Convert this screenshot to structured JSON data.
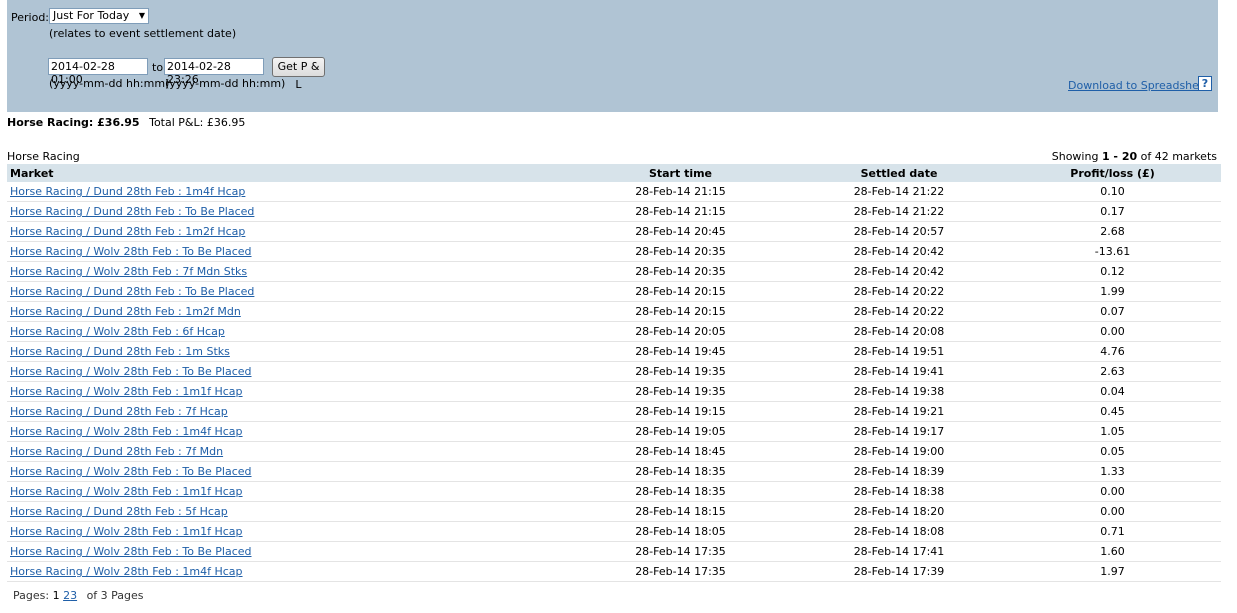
{
  "filter": {
    "period_label": "Period:",
    "period_value": "Just For Today",
    "period_note": "(relates to event settlement date)",
    "from_value": "2014-02-28 01:00",
    "to_label": "to",
    "to_value": "2014-02-28 23:26",
    "button_label": "Get P & L",
    "from_format": "(yyyy-mm-dd hh:mm)",
    "to_format": "(yyyy-mm-dd hh:mm)",
    "download_label": "Download to Spreadsheet",
    "help_label": "?"
  },
  "summary": {
    "sport_label": "Horse Racing: £36.95",
    "total_label": "Total P&L:",
    "total_value": "£36.95"
  },
  "section": {
    "title": "Horse Racing",
    "showing_prefix": "Showing",
    "showing_range": "1 - 20",
    "showing_suffix": "of 42 markets"
  },
  "table": {
    "headers": [
      "Market",
      "Start time",
      "Settled date",
      "Profit/loss (£)"
    ],
    "rows": [
      {
        "market": "Horse Racing / Dund 28th Feb : 1m4f Hcap",
        "start": "28-Feb-14 21:15",
        "settled": "28-Feb-14 21:22",
        "pl": "0.10"
      },
      {
        "market": "Horse Racing / Dund 28th Feb : To Be Placed",
        "start": "28-Feb-14 21:15",
        "settled": "28-Feb-14 21:22",
        "pl": "0.17"
      },
      {
        "market": "Horse Racing / Dund 28th Feb : 1m2f Hcap",
        "start": "28-Feb-14 20:45",
        "settled": "28-Feb-14 20:57",
        "pl": "2.68"
      },
      {
        "market": "Horse Racing / Wolv 28th Feb : To Be Placed",
        "start": "28-Feb-14 20:35",
        "settled": "28-Feb-14 20:42",
        "pl": "-13.61"
      },
      {
        "market": "Horse Racing / Wolv 28th Feb : 7f Mdn Stks",
        "start": "28-Feb-14 20:35",
        "settled": "28-Feb-14 20:42",
        "pl": "0.12"
      },
      {
        "market": "Horse Racing / Dund 28th Feb : To Be Placed",
        "start": "28-Feb-14 20:15",
        "settled": "28-Feb-14 20:22",
        "pl": "1.99"
      },
      {
        "market": "Horse Racing / Dund 28th Feb : 1m2f Mdn",
        "start": "28-Feb-14 20:15",
        "settled": "28-Feb-14 20:22",
        "pl": "0.07"
      },
      {
        "market": "Horse Racing / Wolv 28th Feb : 6f Hcap",
        "start": "28-Feb-14 20:05",
        "settled": "28-Feb-14 20:08",
        "pl": "0.00"
      },
      {
        "market": "Horse Racing / Dund 28th Feb : 1m Stks",
        "start": "28-Feb-14 19:45",
        "settled": "28-Feb-14 19:51",
        "pl": "4.76"
      },
      {
        "market": "Horse Racing / Wolv 28th Feb : To Be Placed",
        "start": "28-Feb-14 19:35",
        "settled": "28-Feb-14 19:41",
        "pl": "2.63"
      },
      {
        "market": "Horse Racing / Wolv 28th Feb : 1m1f Hcap",
        "start": "28-Feb-14 19:35",
        "settled": "28-Feb-14 19:38",
        "pl": "0.04"
      },
      {
        "market": "Horse Racing / Dund 28th Feb : 7f Hcap",
        "start": "28-Feb-14 19:15",
        "settled": "28-Feb-14 19:21",
        "pl": "0.45"
      },
      {
        "market": "Horse Racing / Wolv 28th Feb : 1m4f Hcap",
        "start": "28-Feb-14 19:05",
        "settled": "28-Feb-14 19:17",
        "pl": "1.05"
      },
      {
        "market": "Horse Racing / Dund 28th Feb : 7f Mdn",
        "start": "28-Feb-14 18:45",
        "settled": "28-Feb-14 19:00",
        "pl": "0.05"
      },
      {
        "market": "Horse Racing / Wolv 28th Feb : To Be Placed",
        "start": "28-Feb-14 18:35",
        "settled": "28-Feb-14 18:39",
        "pl": "1.33"
      },
      {
        "market": "Horse Racing / Wolv 28th Feb : 1m1f Hcap",
        "start": "28-Feb-14 18:35",
        "settled": "28-Feb-14 18:38",
        "pl": "0.00"
      },
      {
        "market": "Horse Racing / Dund 28th Feb : 5f Hcap",
        "start": "28-Feb-14 18:15",
        "settled": "28-Feb-14 18:20",
        "pl": "0.00"
      },
      {
        "market": "Horse Racing / Wolv 28th Feb : 1m1f Hcap",
        "start": "28-Feb-14 18:05",
        "settled": "28-Feb-14 18:08",
        "pl": "0.71"
      },
      {
        "market": "Horse Racing / Wolv 28th Feb : To Be Placed",
        "start": "28-Feb-14 17:35",
        "settled": "28-Feb-14 17:41",
        "pl": "1.60"
      },
      {
        "market": "Horse Racing / Wolv 28th Feb : 1m4f Hcap",
        "start": "28-Feb-14 17:35",
        "settled": "28-Feb-14 17:39",
        "pl": "1.97"
      }
    ]
  },
  "pager": {
    "label": "Pages:",
    "current": "1",
    "pages": [
      "2",
      "3"
    ],
    "total_label": "of 3 Pages"
  }
}
